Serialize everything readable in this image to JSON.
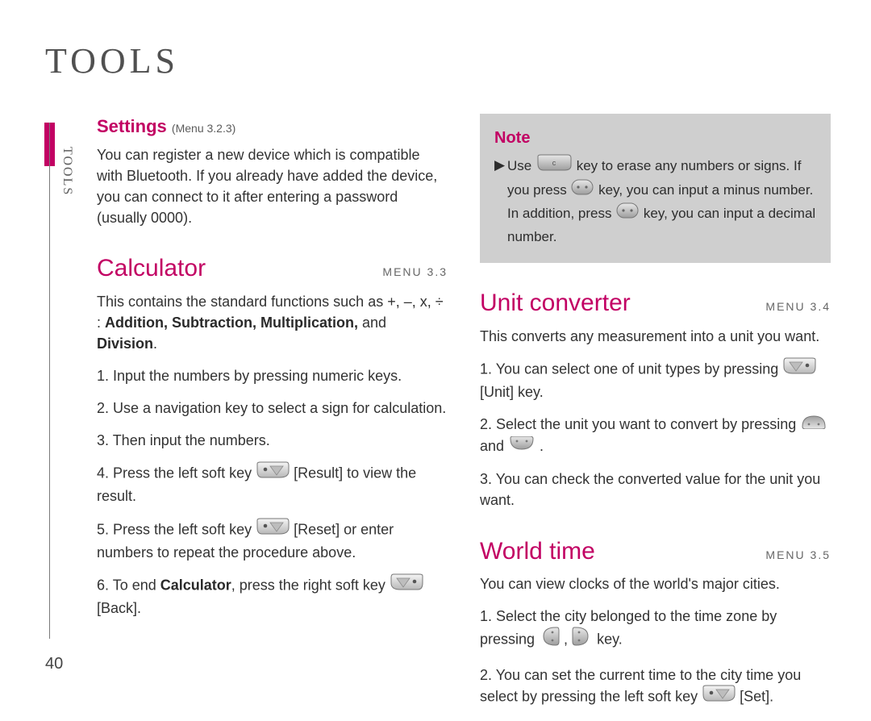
{
  "header": "TOOLS",
  "side_label": "TOOLS",
  "page_number": "40",
  "left": {
    "settings": {
      "title": "Settings",
      "menu": "(Menu 3.2.3)",
      "body": "You can register a new device which is compatible with Bluetooth. If you already have added the device, you can connect to it after entering a password (usually 0000)."
    },
    "calculator": {
      "title": "Calculator",
      "menu": "MENU 3.3",
      "intro_a": "This contains the standard functions such as +, –, x, ÷ : ",
      "intro_bold": "Addition, Subtraction, Multiplication,",
      "intro_b": " and ",
      "intro_bold2": "Division",
      "intro_c": ".",
      "steps": {
        "s1": "1. Input the numbers by pressing numeric keys.",
        "s2": "2. Use a navigation key to select a sign for calculation.",
        "s3": "3. Then input the numbers.",
        "s4a": "4. Press the left soft key ",
        "s4b": " [Result] to view the result.",
        "s5a": "5. Press the left soft key ",
        "s5b": " [Reset] or enter numbers to repeat the procedure above.",
        "s6a": "6. To end ",
        "s6bold": "Calculator",
        "s6b": ", press the right soft key ",
        "s6c": " [Back]."
      }
    }
  },
  "right": {
    "note": {
      "title": "Note",
      "chev": "▶",
      "line_a": "Use ",
      "line_b": " key to erase any numbers or signs. If you press ",
      "line_c": " key, you can input a minus number. In addition, press ",
      "line_d": " key, you can input a decimal number."
    },
    "unit": {
      "title": "Unit converter",
      "menu": "MENU 3.4",
      "intro": "This converts any measurement into a unit you want.",
      "s1a": "1. You can select one of unit types by pressing ",
      "s1b": " [Unit] key.",
      "s2a": "2. Select the unit you want to convert by pressing ",
      "s2b": " and ",
      "s2c": " .",
      "s3": "3. You can check the converted value for the unit you want."
    },
    "world": {
      "title": "World time",
      "menu": "MENU 3.5",
      "intro": "You can view clocks of the world's major cities.",
      "s1a": "1. Select the city belonged to the time zone by pressing ",
      "s1b": " , ",
      "s1c": " key.",
      "s2a": "2. You can set the current time to the city time you select by pressing the left soft key ",
      "s2b": " [Set]."
    }
  }
}
